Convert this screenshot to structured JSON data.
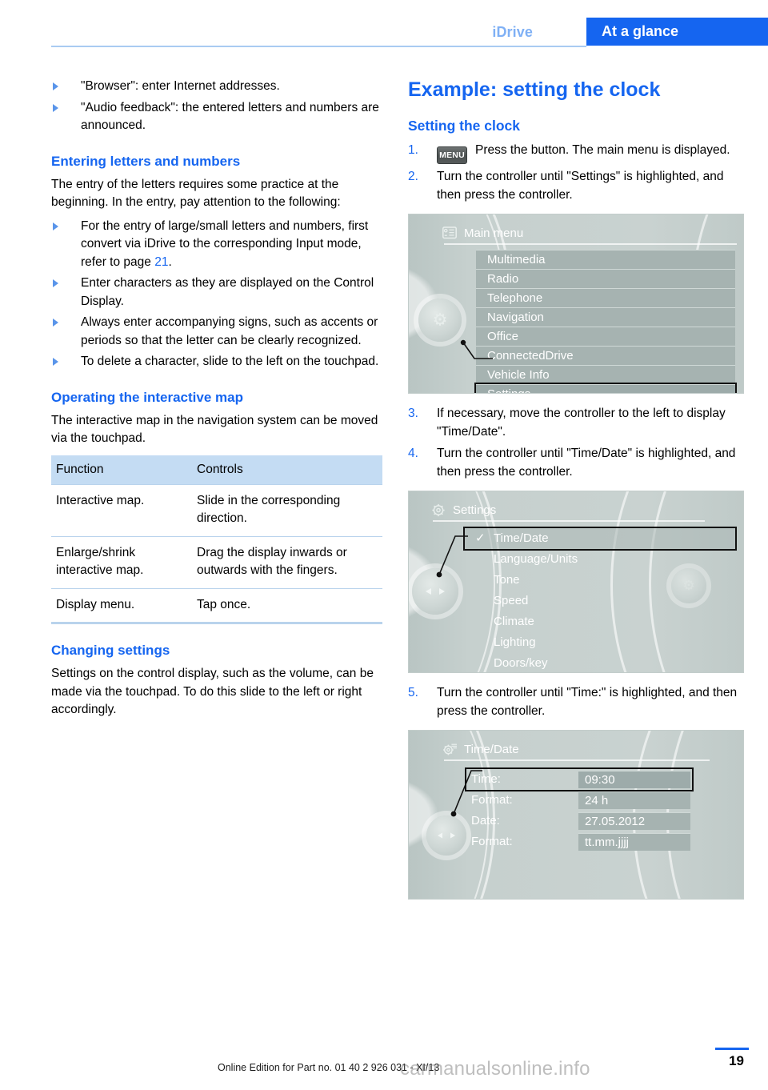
{
  "header": {
    "chapter": "iDrive",
    "section_tab": "At a glance"
  },
  "left_column": {
    "intro_bullets": [
      "\"Browser\": enter Internet addresses.",
      "\"Audio feedback\": the entered letters and numbers are announced."
    ],
    "entering": {
      "heading": "Entering letters and numbers",
      "intro": "The entry of the letters requires some practice at the beginning. In the entry, pay attention to the following:",
      "bullets": [
        {
          "text_before": "For the entry of large/small letters and numbers, first convert via iDrive to the corresponding Input mode, refer to page ",
          "page_ref": "21",
          "text_after": "."
        },
        {
          "text_before": "Enter characters as they are displayed on the Control Display.",
          "page_ref": "",
          "text_after": ""
        },
        {
          "text_before": "Always enter accompanying signs, such as accents or periods so that the letter can be clearly recognized.",
          "page_ref": "",
          "text_after": ""
        },
        {
          "text_before": "To delete a character, slide to the left on the touchpad.",
          "page_ref": "",
          "text_after": ""
        }
      ]
    },
    "interactive_map": {
      "heading": "Operating the interactive map",
      "intro": "The interactive map in the navigation system can be moved via the touchpad.",
      "table": {
        "columns": [
          "Function",
          "Controls"
        ],
        "rows": [
          [
            "Interactive map.",
            "Slide in the corresponding direction."
          ],
          [
            "Enlarge/shrink interactive map.",
            "Drag the display inwards or outwards with the fingers."
          ],
          [
            "Display menu.",
            "Tap once."
          ]
        ]
      }
    },
    "changing_settings": {
      "heading": "Changing settings",
      "body": "Settings on the control display, such as the volume, can be made via the touchpad. To do this slide to the left or right accordingly."
    }
  },
  "right_column": {
    "chapter_title": "Example: setting the clock",
    "subhead": "Setting the clock",
    "steps": [
      {
        "num": "1.",
        "icon": "menu-button",
        "icon_label": "MENU",
        "text": "Press the button. The main menu is displayed."
      },
      {
        "num": "2.",
        "icon": "",
        "icon_label": "",
        "text": "Turn the controller until \"Settings\" is highlighted, and then press the controller."
      },
      {
        "num": "3.",
        "icon": "",
        "icon_label": "",
        "text": "If necessary, move the controller to the left to display \"Time/Date\"."
      },
      {
        "num": "4.",
        "icon": "",
        "icon_label": "",
        "text": "Turn the controller until \"Time/Date\" is highlighted, and then press the controller."
      },
      {
        "num": "5.",
        "icon": "",
        "icon_label": "",
        "text": "Turn the controller until \"Time:\" is highlighted, and then press the controller."
      }
    ],
    "screen_main_menu": {
      "title": "Main menu",
      "title_icon": "list-menu-icon",
      "items": [
        {
          "label": "Multimedia",
          "selected": false
        },
        {
          "label": "Radio",
          "selected": false
        },
        {
          "label": "Telephone",
          "selected": false
        },
        {
          "label": "Navigation",
          "selected": false
        },
        {
          "label": "Office",
          "selected": false
        },
        {
          "label": "ConnectedDrive",
          "selected": false
        },
        {
          "label": "Vehicle Info",
          "selected": false
        },
        {
          "label": "Settings",
          "selected": true
        }
      ]
    },
    "screen_settings": {
      "title": "Settings",
      "title_icon": "gear-icon",
      "items": [
        {
          "label": "Time/Date",
          "selected": true,
          "checked": true
        },
        {
          "label": "Language/Units",
          "selected": false,
          "checked": false
        },
        {
          "label": "Tone",
          "selected": false,
          "checked": false
        },
        {
          "label": "Speed",
          "selected": false,
          "checked": false
        },
        {
          "label": "Climate",
          "selected": false,
          "checked": false
        },
        {
          "label": "Lighting",
          "selected": false,
          "checked": false
        },
        {
          "label": "Doors/key",
          "selected": false,
          "checked": false
        }
      ]
    },
    "screen_time_date": {
      "title": "Time/Date",
      "title_icon": "gear-page-icon",
      "rows": [
        {
          "label": "Time:",
          "value": "09:30",
          "selected": true
        },
        {
          "label": "Format:",
          "value": "24 h",
          "selected": false
        },
        {
          "label": "Date:",
          "value": "27.05.2012",
          "selected": false
        },
        {
          "label": "Format:",
          "value": "tt.mm.jjjj",
          "selected": false
        }
      ]
    }
  },
  "footer": {
    "edition_note": "Online Edition for Part no. 01 40 2 926 031 - XI/13",
    "page_number": "19",
    "watermark": "carmanualsonline.info"
  },
  "colors": {
    "accent_blue": "#1565f0",
    "header_tab_blue": "#1565f0",
    "idrive_light_blue": "#7fb0f5",
    "table_header": "#c4dcf3",
    "screen_row": "#a6b3b1"
  }
}
